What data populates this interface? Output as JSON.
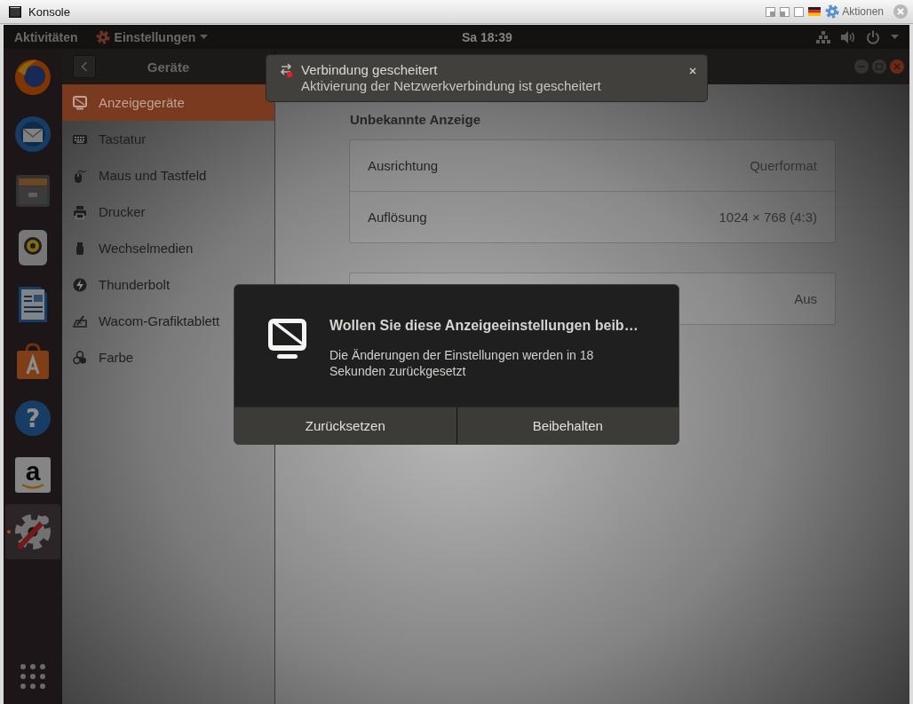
{
  "window": {
    "title": "Konsole",
    "actions_label": "Aktionen"
  },
  "top_bar": {
    "activities": "Aktivitäten",
    "app_menu": "Einstellungen",
    "clock": "Sa 18:39"
  },
  "dock": {
    "items": [
      {
        "kind": "browser",
        "active": false
      },
      {
        "kind": "mail",
        "active": false
      },
      {
        "kind": "files",
        "active": false
      },
      {
        "kind": "music",
        "active": false
      },
      {
        "kind": "writer",
        "active": false
      },
      {
        "kind": "software",
        "active": false
      },
      {
        "kind": "help",
        "glyph": "?",
        "active": false
      },
      {
        "kind": "amazon",
        "glyph": "a",
        "active": false
      },
      {
        "kind": "settings",
        "active": true
      }
    ]
  },
  "settings": {
    "sidebar_title": "Geräte",
    "sidebar": {
      "items": [
        {
          "label": "Anzeigegeräte",
          "selected": true
        },
        {
          "label": "Tastatur",
          "selected": false
        },
        {
          "label": "Maus und Tastfeld",
          "selected": false
        },
        {
          "label": "Drucker",
          "selected": false
        },
        {
          "label": "Wechselmedien",
          "selected": false
        },
        {
          "label": "Thunderbolt",
          "selected": false
        },
        {
          "label": "Wacom-Grafiktablett",
          "selected": false
        },
        {
          "label": "Farbe",
          "selected": false
        }
      ]
    },
    "section_title": "Unbekannte Anzeige",
    "rows": [
      {
        "label": "Ausrichtung",
        "value": "Querformat"
      },
      {
        "label": "Auflösung",
        "value": "1024 × 768 (4:3)"
      }
    ],
    "night_row": {
      "value": "Aus"
    }
  },
  "notification": {
    "title": "Verbindung gescheitert",
    "body": "Aktivierung der Netzwerkverbindung ist gescheitert"
  },
  "dialog": {
    "title": "Wollen Sie diese Anzeigeeinstellungen beib…",
    "message": "Die Änderungen der Einstellungen werden in 18 Sekunden zurückgesetzt",
    "buttons": [
      "Zurücksetzen",
      "Beibehalten"
    ]
  }
}
